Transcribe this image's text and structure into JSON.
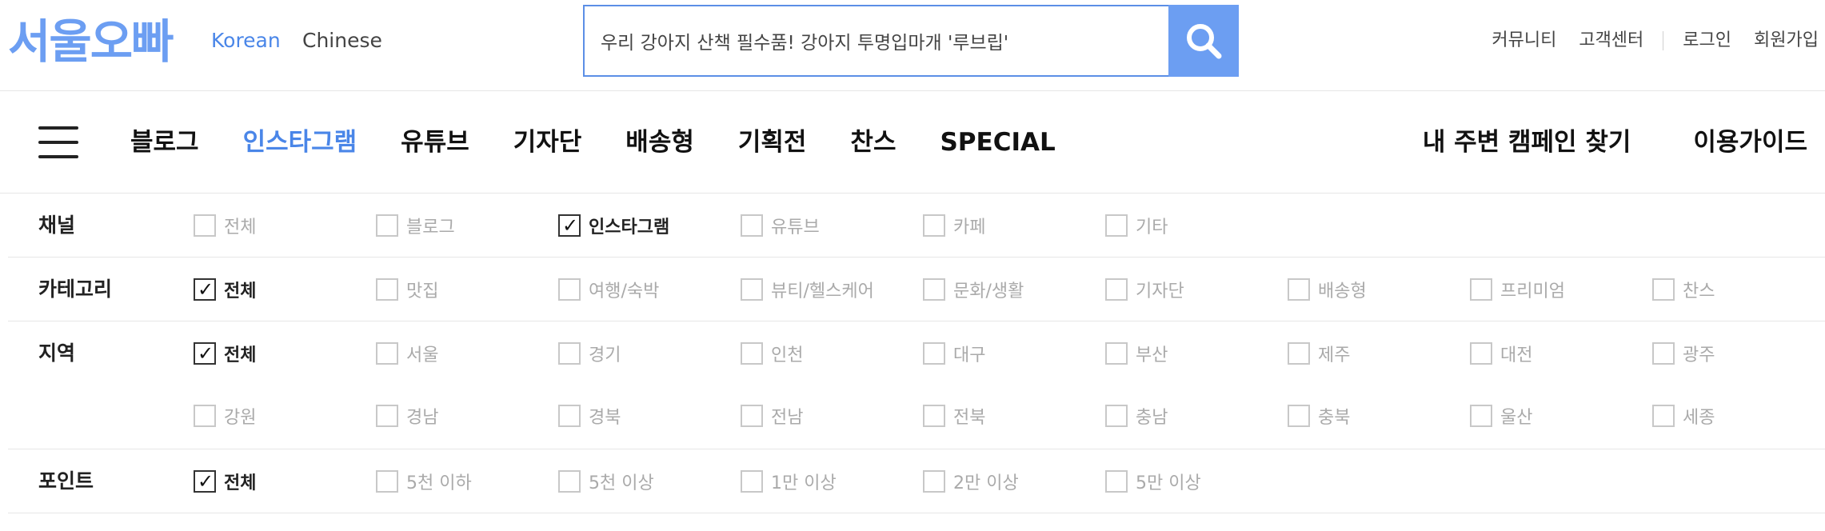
{
  "header": {
    "logo": "서울오빠",
    "languages": [
      "Korean",
      "Chinese"
    ],
    "search_value": "우리 강아지 산책 필수품! 강아지 투명입마개 '루브립'",
    "links": [
      "커뮤니티",
      "고객센터",
      "로그인",
      "회원가입"
    ],
    "colors": {
      "brand": "#6c9ef2",
      "active": "#4a86e8"
    }
  },
  "nav": {
    "menu": [
      "블로그",
      "인스타그램",
      "유튜브",
      "기자단",
      "배송형",
      "기획전",
      "찬스",
      "SPECIAL"
    ],
    "active_index": 1,
    "right": [
      "내 주변 캠페인 찾기",
      "이용가이드"
    ]
  },
  "filters": {
    "channel": {
      "label": "채널",
      "options": [
        "전체",
        "블로그",
        "인스타그램",
        "유튜브",
        "카페",
        "기타"
      ],
      "checked": [
        false,
        false,
        true,
        false,
        false,
        false
      ]
    },
    "category": {
      "label": "카테고리",
      "options": [
        "전체",
        "맛집",
        "여행/숙박",
        "뷰티/헬스케어",
        "문화/생활",
        "기자단",
        "배송형",
        "프리미엄",
        "찬스"
      ],
      "checked": [
        true,
        false,
        false,
        false,
        false,
        false,
        false,
        false,
        false
      ]
    },
    "region": {
      "label": "지역",
      "options_row1": [
        "전체",
        "서울",
        "경기",
        "인천",
        "대구",
        "부산",
        "제주",
        "대전",
        "광주"
      ],
      "options_row2": [
        "강원",
        "경남",
        "경북",
        "전남",
        "전북",
        "충남",
        "충북",
        "울산",
        "세종"
      ],
      "checked_row1": [
        true,
        false,
        false,
        false,
        false,
        false,
        false,
        false,
        false
      ],
      "checked_row2": [
        false,
        false,
        false,
        false,
        false,
        false,
        false,
        false,
        false
      ]
    },
    "point": {
      "label": "포인트",
      "options": [
        "전체",
        "5천 이하",
        "5천 이상",
        "1만 이상",
        "2만 이상",
        "5만 이상"
      ],
      "checked": [
        true,
        false,
        false,
        false,
        false,
        false
      ]
    }
  }
}
